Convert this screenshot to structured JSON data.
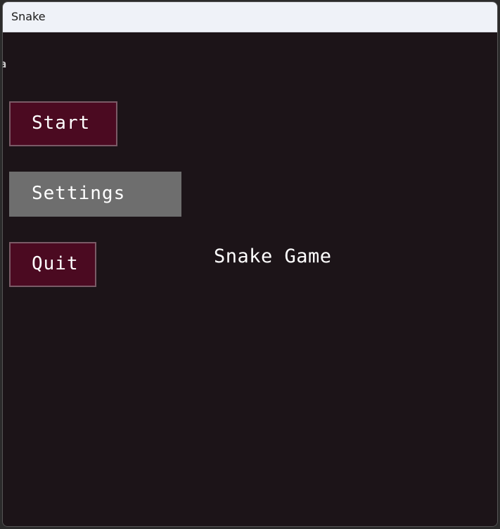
{
  "window": {
    "title": "Snake"
  },
  "menu": {
    "buttons": [
      {
        "label": "Start",
        "state": "normal"
      },
      {
        "label": "Settings",
        "state": "hover"
      },
      {
        "label": "Quit",
        "state": "normal"
      }
    ]
  },
  "game": {
    "title": "Snake Game",
    "edge_glyph": "a"
  },
  "colors": {
    "background": "#1c1418",
    "button_fill": "#4b0a21",
    "button_border": "#7a5a66",
    "button_hover": "#6e6e6e",
    "text": "#ffffff",
    "titlebar": "#eff2f8"
  }
}
